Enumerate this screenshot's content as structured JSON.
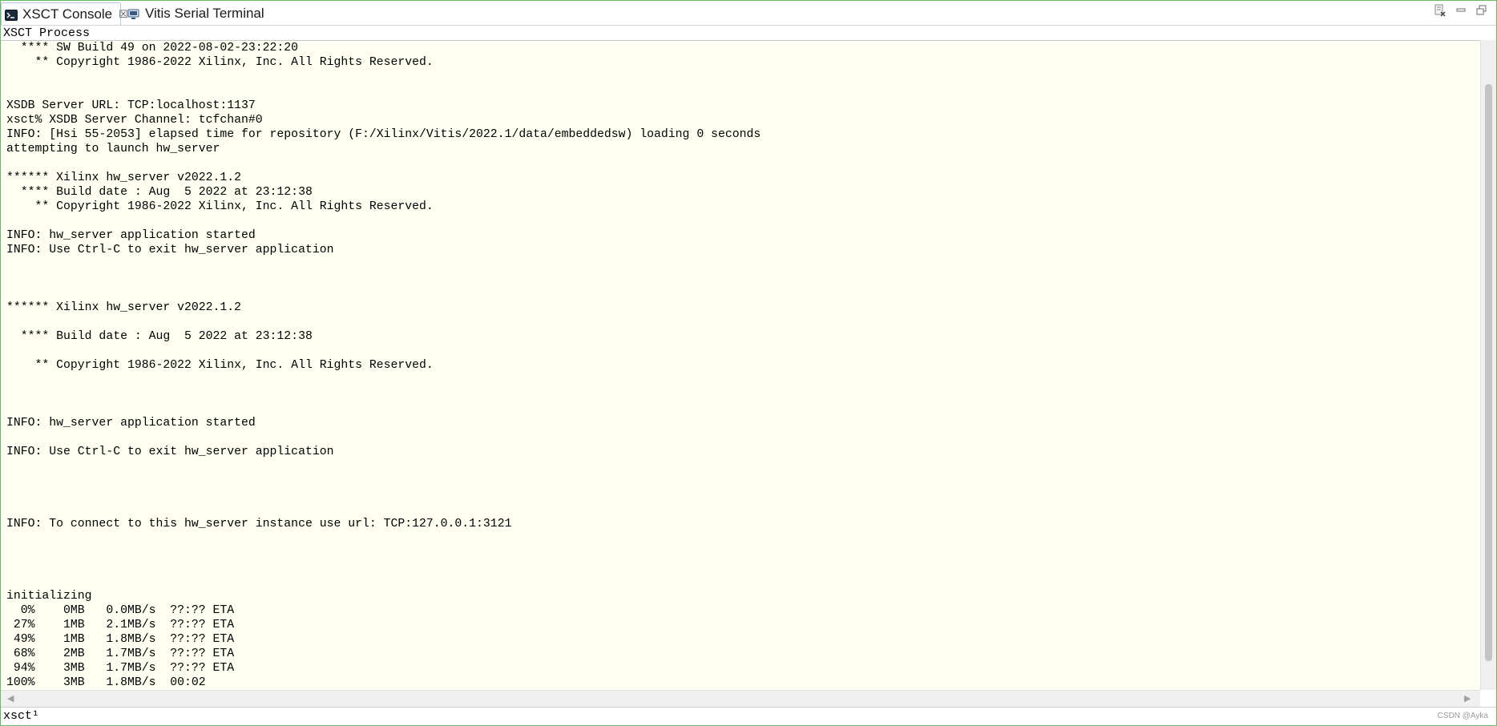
{
  "tabs": [
    {
      "label": "XSCT Console",
      "icon": "terminal-console-icon",
      "active": true,
      "close_glyph": "☒"
    },
    {
      "label": "Vitis Serial Terminal",
      "icon": "monitor-terminal-icon",
      "active": false
    }
  ],
  "toolbar": {
    "icons": [
      "clear-console-icon",
      "minimize-icon",
      "maximize-icon"
    ]
  },
  "process_label": "XSCT Process",
  "console": {
    "lines": [
      "  **** SW Build 49 on 2022-08-02-23:22:20",
      "    ** Copyright 1986-2022 Xilinx, Inc. All Rights Reserved.",
      "",
      "",
      "XSDB Server URL: TCP:localhost:1137",
      "xsct% XSDB Server Channel: tcfchan#0",
      "INFO: [Hsi 55-2053] elapsed time for repository (F:/Xilinx/Vitis/2022.1/data/embeddedsw) loading 0 seconds",
      "attempting to launch hw_server",
      "",
      "****** Xilinx hw_server v2022.1.2",
      "  **** Build date : Aug  5 2022 at 23:12:38",
      "    ** Copyright 1986-2022 Xilinx, Inc. All Rights Reserved.",
      "",
      "INFO: hw_server application started",
      "INFO: Use Ctrl-C to exit hw_server application",
      "",
      "",
      "",
      "****** Xilinx hw_server v2022.1.2",
      "",
      "  **** Build date : Aug  5 2022 at 23:12:38",
      "",
      "    ** Copyright 1986-2022 Xilinx, Inc. All Rights Reserved.",
      "",
      "",
      "",
      "INFO: hw_server application started",
      "",
      "INFO: Use Ctrl-C to exit hw_server application",
      "",
      "",
      "",
      "",
      "INFO: To connect to this hw_server instance use url: TCP:127.0.0.1:3121",
      "",
      "",
      "",
      "",
      "initializing",
      "  0%    0MB   0.0MB/s  ??:?? ETA",
      " 27%    1MB   2.1MB/s  ??:?? ETA",
      " 49%    1MB   1.8MB/s  ??:?? ETA",
      " 68%    2MB   1.7MB/s  ??:?? ETA",
      " 94%    3MB   1.7MB/s  ??:?? ETA",
      "100%    3MB   1.8MB/s  00:02"
    ]
  },
  "scrollbars": {
    "h_left_arrow": "◀",
    "h_right_arrow": "▶"
  },
  "prompt": "xsct¹",
  "watermark": "CSDN @Ayka",
  "colors": {
    "console_bg": "#fffff2",
    "window_border": "#5fbf5f"
  }
}
